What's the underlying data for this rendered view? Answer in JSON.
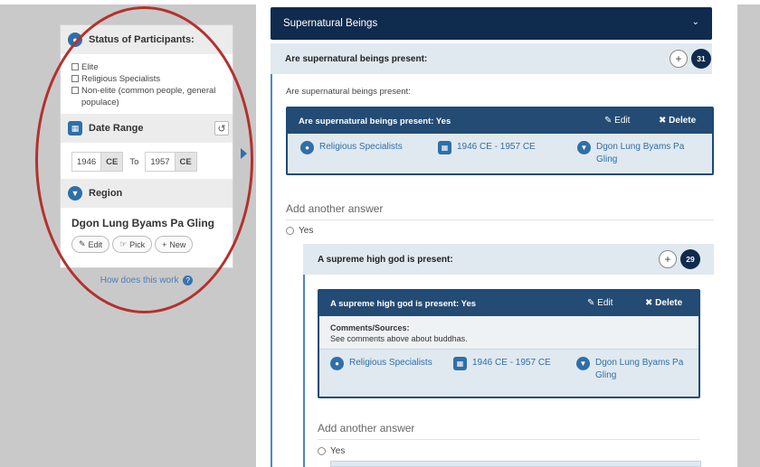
{
  "filters": {
    "participants": {
      "title": "Status of Participants:",
      "options": [
        "Elite",
        "Religious Specialists",
        "Non-elite (common people, general populace)"
      ]
    },
    "date_range": {
      "title": "Date Range",
      "from_year": "1946",
      "from_era": "CE",
      "to_label": "To",
      "to_year": "1957",
      "to_era": "CE"
    },
    "region": {
      "title": "Region",
      "name": "Dgon Lung Byams Pa Gling",
      "buttons": {
        "edit": "Edit",
        "pick": "Pick",
        "new": "New"
      }
    },
    "help_link": "How does this work"
  },
  "main": {
    "section_title": "Supernatural Beings",
    "q1": {
      "label": "Are supernatural beings present:",
      "count": "31",
      "prompt": "Are supernatural beings present:",
      "answer_header": "Are supernatural beings present: Yes",
      "edit": "Edit",
      "delete": "Delete",
      "status": "Religious Specialists",
      "dates": "1946 CE - 1957 CE",
      "region": "Dgon Lung Byams Pa Gling"
    },
    "add_another_1": "Add another answer",
    "yes_1": "Yes",
    "q2": {
      "label": "A supreme high god is present:",
      "count": "29",
      "answer_header": "A supreme high god is present: Yes",
      "edit": "Edit",
      "delete": "Delete",
      "comments_label": "Comments/Sources:",
      "comments_text": "See comments above about buddhas.",
      "status": "Religious Specialists",
      "dates": "1946 CE - 1957 CE",
      "region": "Dgon Lung Byams Pa Gling"
    },
    "add_another_2": "Add another answer",
    "yes_2": "Yes"
  },
  "colors": {
    "navy": "#0f2b4d",
    "accent_blue": "#2f6fa8",
    "annotation_red": "#b4312c",
    "row_bg": "#e0e9f0"
  }
}
